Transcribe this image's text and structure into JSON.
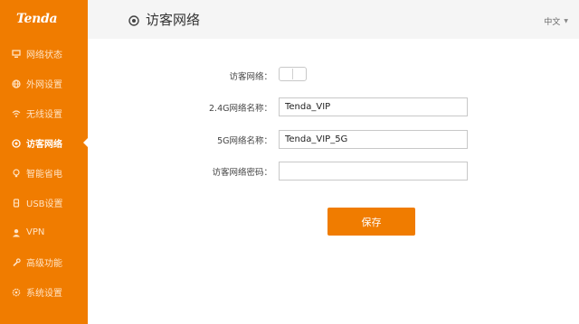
{
  "brand": {
    "logo_text": "Tenda",
    "accent_color": "#f07c00"
  },
  "sidebar": {
    "items": [
      {
        "label": "网络状态",
        "icon": "network-status-icon",
        "active": false
      },
      {
        "label": "外网设置",
        "icon": "globe-icon",
        "active": false
      },
      {
        "label": "无线设置",
        "icon": "wifi-icon",
        "active": false
      },
      {
        "label": "访客网络",
        "icon": "guest-network-icon",
        "active": true
      },
      {
        "label": "智能省电",
        "icon": "bulb-icon",
        "active": false
      },
      {
        "label": "USB设置",
        "icon": "usb-icon",
        "active": false
      },
      {
        "label": "VPN",
        "icon": "user-icon",
        "active": false
      },
      {
        "label": "高级功能",
        "icon": "wrench-icon",
        "active": false
      },
      {
        "label": "系统设置",
        "icon": "gear-icon",
        "active": false
      }
    ]
  },
  "header": {
    "title": "访客网络",
    "title_icon": "guest-network-icon",
    "language": "中文"
  },
  "form": {
    "guest_network_label": "访客网络：",
    "guest_network_enabled": false,
    "ssid_24g_label": "2.4G网络名称：",
    "ssid_24g_value": "Tenda_VIP",
    "ssid_5g_label": "5G网络名称：",
    "ssid_5g_value": "Tenda_VIP_5G",
    "password_label": "访客网络密码：",
    "password_value": "",
    "save_label": "保存"
  }
}
